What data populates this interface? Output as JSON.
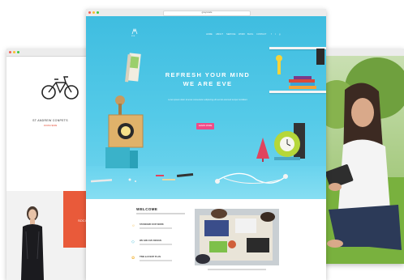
{
  "center": {
    "url": "grayscale",
    "brand": "EVE",
    "nav": [
      "HOME",
      "ABOUT",
      "SERVICE",
      "WORK",
      "BLOG",
      "CONTACT"
    ],
    "social": [
      "f",
      "t",
      "g"
    ],
    "headline1": "REFRESH YOUR MIND",
    "headline2": "WE ARE EVE",
    "subtext": "Lorem ipsum dolor sit amet consectetur adipiscing elit sed do eiusmod tempor incididunt",
    "cta": "LEARN MORE",
    "welcome": "WELCOME",
    "features": [
      {
        "icon": "lightbulb-icon",
        "title": "STANDARD OUR WORK"
      },
      {
        "icon": "diamond-icon",
        "title": "WE ARE EVE DESIGN"
      },
      {
        "icon": "ribbon-icon",
        "title": "TIME & EVENT PLAN"
      }
    ]
  },
  "left": {
    "product_title": "ST ANDREW CONPETS",
    "product_price": "FROM $999",
    "promo": "SOCI"
  },
  "colors": {
    "hero": "#3fbde0",
    "cta": "#ef4a86",
    "accent_orange": "#e95a3a",
    "feature_icon": "#f2b233"
  }
}
